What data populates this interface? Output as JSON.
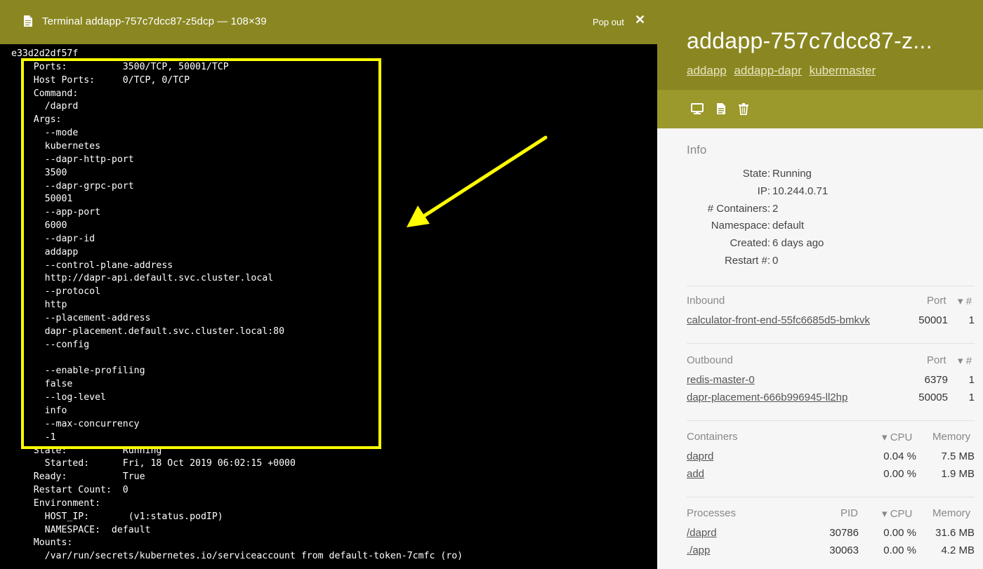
{
  "terminal": {
    "title": "Terminal addapp-757c7dcc87-z5dcp — 108×39",
    "popout_label": "Pop out",
    "close_glyph": "✕",
    "lines": [
      "e33d2d2df57f",
      "    Ports:          3500/TCP, 50001/TCP",
      "    Host Ports:     0/TCP, 0/TCP",
      "    Command:",
      "      /daprd",
      "    Args:",
      "      --mode",
      "      kubernetes",
      "      --dapr-http-port",
      "      3500",
      "      --dapr-grpc-port",
      "      50001",
      "      --app-port",
      "      6000",
      "      --dapr-id",
      "      addapp",
      "      --control-plane-address",
      "      http://dapr-api.default.svc.cluster.local",
      "      --protocol",
      "      http",
      "      --placement-address",
      "      dapr-placement.default.svc.cluster.local:80",
      "      --config",
      "",
      "      --enable-profiling",
      "      false",
      "      --log-level",
      "      info",
      "      --max-concurrency",
      "      -1",
      "    State:          Running",
      "      Started:      Fri, 18 Oct 2019 06:02:15 +0000",
      "    Ready:          True",
      "    Restart Count:  0",
      "    Environment:",
      "      HOST_IP:       (v1:status.podIP)",
      "      NAMESPACE:  default",
      "    Mounts:",
      "      /var/run/secrets/kubernetes.io/serviceaccount from default-token-7cmfc (ro)"
    ]
  },
  "pod": {
    "title": "addapp-757c7dcc87-z...",
    "links": [
      "addapp",
      "addapp-dapr",
      "kubermaster"
    ],
    "toolbar_icons": [
      "terminal-icon",
      "document-icon",
      "trash-icon"
    ]
  },
  "info": {
    "title": "Info",
    "rows": [
      {
        "k": "State:",
        "v": "Running"
      },
      {
        "k": "IP:",
        "v": "10.244.0.71"
      },
      {
        "k": "# Containers:",
        "v": "2"
      },
      {
        "k": "Namespace:",
        "v": "default"
      },
      {
        "k": "Created:",
        "v": "6 days ago"
      },
      {
        "k": "Restart #:",
        "v": "0"
      }
    ]
  },
  "inbound": {
    "title": "Inbound",
    "col_port": "Port",
    "col_count": "▾ #",
    "rows": [
      {
        "name": "calculator-front-end-55fc6685d5-bmkvk",
        "port": "50001",
        "count": "1"
      }
    ]
  },
  "outbound": {
    "title": "Outbound",
    "col_port": "Port",
    "col_count": "▾ #",
    "rows": [
      {
        "name": "redis-master-0",
        "port": "6379",
        "count": "1"
      },
      {
        "name": "dapr-placement-666b996945-ll2hp",
        "port": "50005",
        "count": "1"
      }
    ]
  },
  "containers": {
    "title": "Containers",
    "col_cpu": "▾ CPU",
    "col_mem": "Memory",
    "rows": [
      {
        "name": "daprd",
        "cpu": "0.04 %",
        "mem": "7.5 MB"
      },
      {
        "name": "add",
        "cpu": "0.00 %",
        "mem": "1.9 MB"
      }
    ]
  },
  "processes": {
    "title": "Processes",
    "col_pid": "PID",
    "col_cpu": "▾ CPU",
    "col_mem": "Memory",
    "rows": [
      {
        "name": "/daprd",
        "pid": "30786",
        "cpu": "0.00 %",
        "mem": "31.6 MB"
      },
      {
        "name": "./app",
        "pid": "30063",
        "cpu": "0.00 %",
        "mem": "4.2 MB"
      }
    ]
  },
  "colors": {
    "header_olive": "#8a8722",
    "toolbar_olive": "#9b982c",
    "highlight": "#ffff00",
    "terminal_bg": "#000000"
  }
}
